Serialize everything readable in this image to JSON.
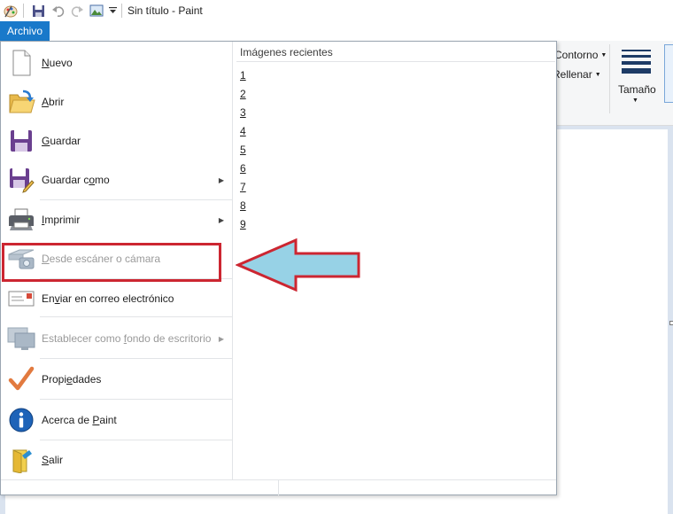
{
  "window": {
    "title": "Sin título - Paint"
  },
  "tabs": {
    "file": "Archivo"
  },
  "ribbon": {
    "outline": "Contorno",
    "fill": "Rellenar",
    "size": "Tamaño"
  },
  "menu": {
    "items": [
      {
        "pre": "",
        "key": "N",
        "post": "uevo",
        "icon": "new-document-icon"
      },
      {
        "pre": "",
        "key": "A",
        "post": "brir",
        "icon": "open-folder-icon"
      },
      {
        "pre": "",
        "key": "G",
        "post": "uardar",
        "icon": "save-floppy-icon"
      },
      {
        "pre": "Guardar c",
        "key": "o",
        "post": "mo",
        "icon": "save-as-icon"
      },
      {
        "pre": "",
        "key": "I",
        "post": "mprimir",
        "icon": "printer-icon"
      },
      {
        "pre": "",
        "key": "D",
        "post": "esde escáner o cámara",
        "icon": "scanner-camera-icon"
      },
      {
        "pre": "En",
        "key": "v",
        "post": "iar en correo electrónico",
        "icon": "email-icon"
      },
      {
        "pre": "Establecer como ",
        "key": "f",
        "post": "ondo de escritorio",
        "icon": "desktop-background-icon"
      },
      {
        "pre": "Propi",
        "key": "e",
        "post": "dades",
        "icon": "properties-check-icon"
      },
      {
        "pre": "Acerca de ",
        "key": "P",
        "post": "aint",
        "icon": "info-icon"
      },
      {
        "pre": "",
        "key": "S",
        "post": "alir",
        "icon": "exit-icon"
      }
    ],
    "submenu_arrow": "▶",
    "recent_title": "Imágenes recientes",
    "recent": [
      "1",
      "2",
      "3",
      "4",
      "5",
      "6",
      "7",
      "8",
      "9"
    ]
  },
  "annotation": {
    "highlight_color": "#cc2631",
    "arrow_fill": "#97d2e6"
  }
}
